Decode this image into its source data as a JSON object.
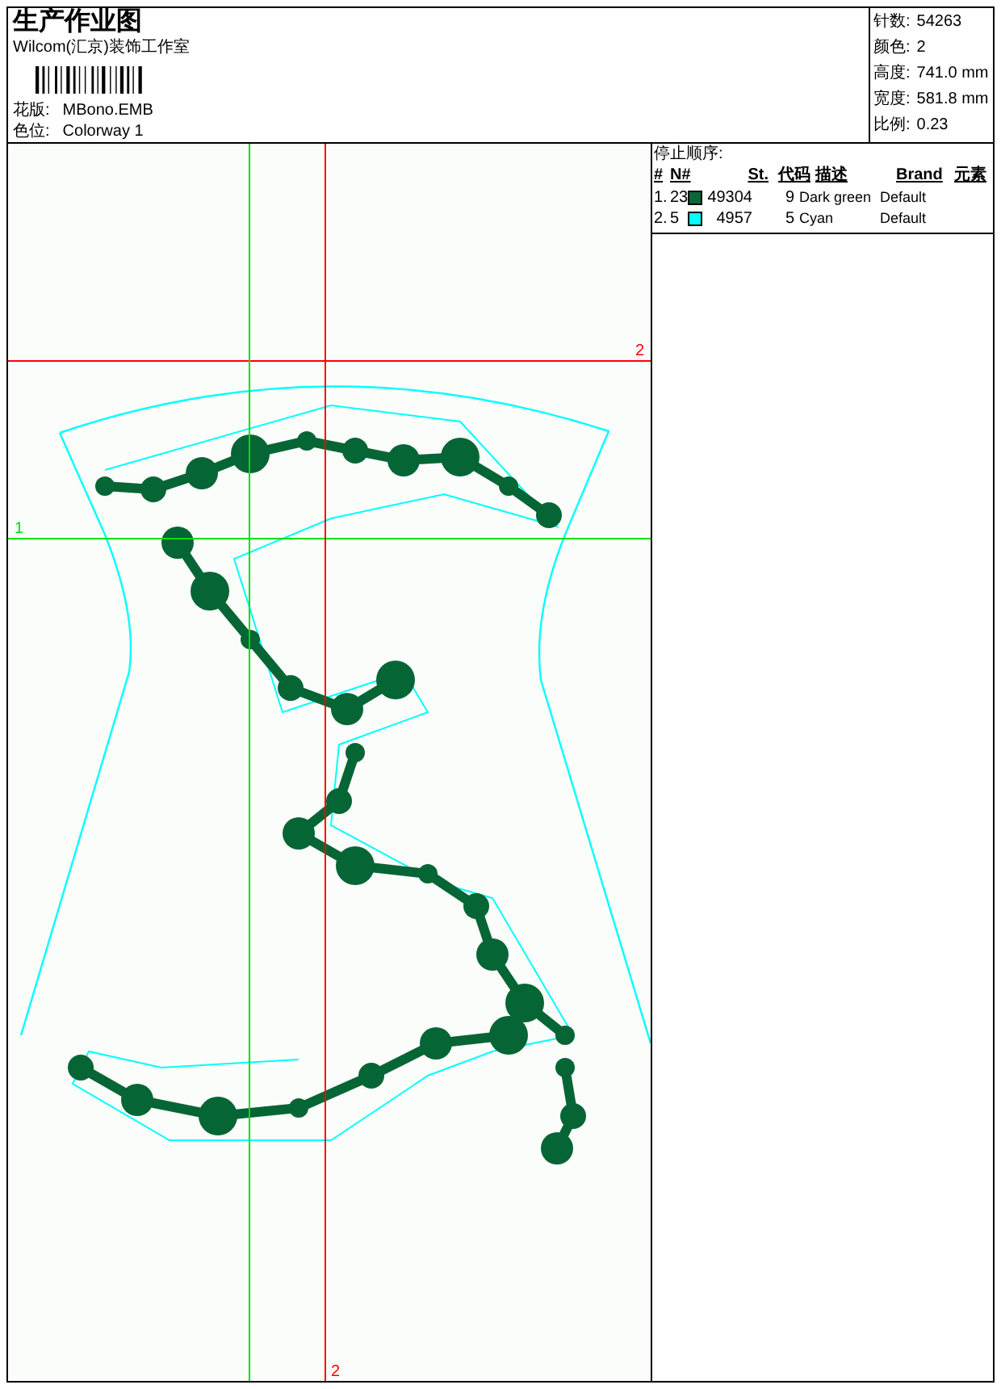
{
  "header": {
    "title": "生产作业图",
    "company": "Wilcom(汇京)装饰工作室",
    "fields": [
      {
        "label": "花版:",
        "value": "MBono.EMB"
      },
      {
        "label": "色位:",
        "value": "Colorway 1"
      }
    ]
  },
  "stats": [
    {
      "label": "针数:",
      "value": "54263"
    },
    {
      "label": "颜色:",
      "value": "2"
    },
    {
      "label": "高度:",
      "value": "741.0 mm"
    },
    {
      "label": "宽度:",
      "value": "581.8 mm"
    },
    {
      "label": "比例:",
      "value": "0.23"
    }
  ],
  "canvas": {
    "guides": [
      {
        "label": "2",
        "color": "#ff0000",
        "kind": "horizontal"
      },
      {
        "label": "1",
        "color": "#00e000",
        "kind": "horizontal"
      },
      {
        "color": "#00e000",
        "kind": "vertical"
      },
      {
        "label": "2",
        "color": "#ff0000",
        "kind": "vertical"
      }
    ]
  },
  "stop_sequence": {
    "title": "停止顺序:",
    "columns": [
      "#",
      "N#",
      "St.",
      "代码",
      "描述",
      "Brand",
      "元素"
    ],
    "rows": [
      {
        "index": "1.",
        "number": "23",
        "color": "#086838",
        "stitches": "49304",
        "code": "9",
        "description": "Dark green",
        "brand": "Default"
      },
      {
        "index": "2.",
        "number": "5",
        "color": "#00ffff",
        "stitches": "4957",
        "code": "5",
        "description": "Cyan",
        "brand": "Default"
      }
    ]
  }
}
